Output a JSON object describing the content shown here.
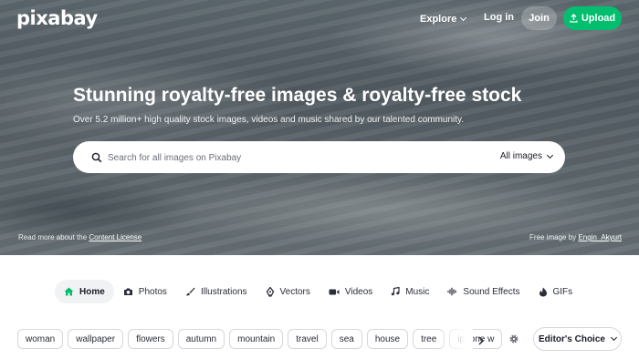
{
  "brand": {
    "logo": "pixabay",
    "accent_color": "#02be6e"
  },
  "header": {
    "explore_label": "Explore",
    "login_label": "Log in",
    "join_label": "Join",
    "upload_label": "Upload"
  },
  "hero": {
    "title": "Stunning royalty-free images & royalty-free stock",
    "subtitle": "Over 5.2 million+ high quality stock images, videos and music shared by our talented community.",
    "search_placeholder": "Search for all images on Pixabay",
    "search_filter": "All images",
    "license_prefix": "Read more about the",
    "license_link": "Content License",
    "credit_prefix": "Free image by",
    "credit_author": "Engin_Akyurt"
  },
  "tabs": [
    {
      "label": "Home",
      "icon": "home-icon",
      "active": true
    },
    {
      "label": "Photos",
      "icon": "camera-icon"
    },
    {
      "label": "Illustrations",
      "icon": "brush-icon"
    },
    {
      "label": "Vectors",
      "icon": "pen-nib-icon"
    },
    {
      "label": "Videos",
      "icon": "video-camera-icon"
    },
    {
      "label": "Music",
      "icon": "music-note-icon"
    },
    {
      "label": "Sound Effects",
      "icon": "sound-wave-icon"
    },
    {
      "label": "GIFs",
      "icon": "gif-icon"
    }
  ],
  "tags": [
    "woman",
    "wallpaper",
    "flowers",
    "autumn",
    "mountain",
    "travel",
    "sea",
    "house",
    "tree",
    "iphone w"
  ],
  "filters": {
    "sort_label": "Editor's Choice"
  }
}
